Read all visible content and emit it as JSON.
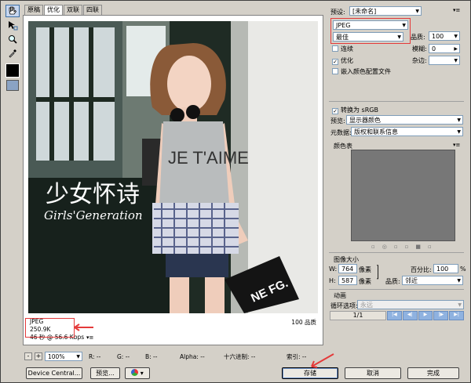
{
  "tabs": [
    "原稿",
    "优化",
    "双联",
    "四联"
  ],
  "active_tab": 1,
  "tools": [
    "hand-icon",
    "slice-select-icon",
    "zoom-icon",
    "eyedropper-icon"
  ],
  "photo": {
    "shirt_text": "JE T'AIME",
    "watermark_cn": "少女怀诗",
    "watermark_en": "Girls'Generation",
    "bag_text": "NE FG."
  },
  "info": {
    "format": "JPEG",
    "size": "250.9K",
    "time": "46 秒 @ 56.6 Kbps",
    "quality": "100 品质"
  },
  "status": {
    "zoom": "100%",
    "r": "R: --",
    "g": "G: --",
    "b": "B: --",
    "alpha": "Alpha: --",
    "hex": "十六进制: --",
    "index": "索引: --"
  },
  "buttons": {
    "device_central": "Device Central...",
    "preview": "预览...",
    "save": "存储",
    "cancel": "取消",
    "done": "完成"
  },
  "panel": {
    "preset_label": "预设:",
    "preset_value": "[未命名]",
    "format": "JPEG",
    "quality_preset": "最佳",
    "quality_label": "品质:",
    "quality_value": "100",
    "progressive": "连续",
    "blur_label": "模糊:",
    "blur_value": "0",
    "optimized": "优化",
    "matte_label": "杂边:",
    "embed_profile": "嵌入颜色配置文件",
    "convert_srgb": "转换为 sRGB",
    "preview_label": "预览:",
    "preview_value": "显示器颜色",
    "metadata_label": "元数据:",
    "metadata_value": "版权和联系信息",
    "color_table": "颜色表",
    "image_size": "图像大小",
    "w_label": "W:",
    "w_value": "764",
    "h_label": "H:",
    "h_value": "587",
    "unit": "像素",
    "percent_label": "百分比:",
    "percent_value": "100",
    "percent_unit": "%",
    "resample_label": "品质:",
    "resample_value": "邻近",
    "animation": "动画",
    "loop_label": "循环选项:",
    "loop_value": "永远",
    "frame_counter": "1/1"
  },
  "colors": {
    "accent_red": "#e43a3a",
    "panel_bg": "#d4d0c8"
  }
}
